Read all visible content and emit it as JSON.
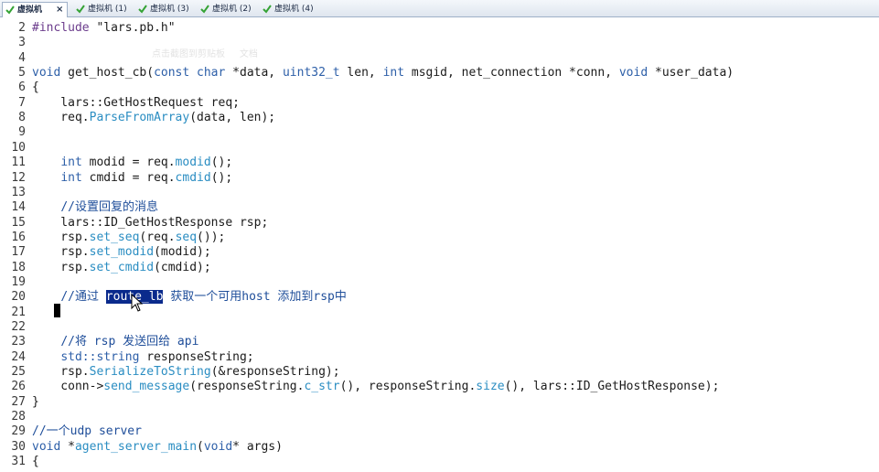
{
  "tabs": [
    {
      "label": "虚拟机",
      "active": true,
      "close": "×"
    },
    {
      "label": "虚拟机 (1)",
      "active": false
    },
    {
      "label": "虚拟机 (3)",
      "active": false
    },
    {
      "label": "虚拟机 (2)",
      "active": false
    },
    {
      "label": "虚拟机 (4)",
      "active": false
    }
  ],
  "ghost_overlay": "点击截图到剪贴板     文档",
  "colors": {
    "keyword": "#2d5fa8",
    "function_call": "#2a8dc2",
    "comment": "#1f4e9a",
    "selection": "#0a2a8c",
    "tab_check": "#35a335"
  },
  "editor": {
    "lines": [
      {
        "num": "2",
        "tokens": [
          [
            "pre",
            "#include"
          ],
          [
            "str",
            " \"lars.pb.h\""
          ]
        ]
      },
      {
        "num": "3",
        "tokens": []
      },
      {
        "num": "4",
        "tokens": []
      },
      {
        "num": "5",
        "tokens": [
          [
            "kw",
            "void"
          ],
          [
            "",
            " get_host_cb("
          ],
          [
            "kw",
            "const"
          ],
          [
            "",
            " "
          ],
          [
            "kw",
            "char"
          ],
          [
            "",
            " *data, "
          ],
          [
            "kw",
            "uint32_t"
          ],
          [
            "",
            " len, "
          ],
          [
            "kw",
            "int"
          ],
          [
            "",
            " msgid, net_connection *conn, "
          ],
          [
            "kw",
            "void"
          ],
          [
            "",
            " *user_data)"
          ]
        ]
      },
      {
        "num": "6",
        "tokens": [
          [
            "",
            "{"
          ]
        ]
      },
      {
        "num": "7",
        "tokens": [
          [
            "",
            "    lars::GetHostRequest req;"
          ]
        ]
      },
      {
        "num": "8",
        "tokens": [
          [
            "",
            "    req."
          ],
          [
            "fn",
            "ParseFromArray"
          ],
          [
            "",
            "(data, len);"
          ]
        ]
      },
      {
        "num": "9",
        "tokens": []
      },
      {
        "num": "10",
        "tokens": []
      },
      {
        "num": "11",
        "tokens": [
          [
            "",
            "    "
          ],
          [
            "kw",
            "int"
          ],
          [
            "",
            " modid = req."
          ],
          [
            "fn",
            "modid"
          ],
          [
            "",
            "();"
          ]
        ]
      },
      {
        "num": "12",
        "tokens": [
          [
            "",
            "    "
          ],
          [
            "kw",
            "int"
          ],
          [
            "",
            " cmdid = req."
          ],
          [
            "fn",
            "cmdid"
          ],
          [
            "",
            "();"
          ]
        ]
      },
      {
        "num": "13",
        "tokens": []
      },
      {
        "num": "14",
        "tokens": [
          [
            "",
            "    "
          ],
          [
            "cmt",
            "//设置回复的消息"
          ]
        ]
      },
      {
        "num": "15",
        "tokens": [
          [
            "",
            "    lars::ID_GetHostResponse rsp;"
          ]
        ]
      },
      {
        "num": "16",
        "tokens": [
          [
            "",
            "    rsp."
          ],
          [
            "fn",
            "set_seq"
          ],
          [
            "",
            "(req."
          ],
          [
            "fn",
            "seq"
          ],
          [
            "",
            "());"
          ]
        ]
      },
      {
        "num": "17",
        "tokens": [
          [
            "",
            "    rsp."
          ],
          [
            "fn",
            "set_modid"
          ],
          [
            "",
            "(modid);"
          ]
        ]
      },
      {
        "num": "18",
        "tokens": [
          [
            "",
            "    rsp."
          ],
          [
            "fn",
            "set_cmdid"
          ],
          [
            "",
            "(cmdid);"
          ]
        ]
      },
      {
        "num": "19",
        "tokens": []
      },
      {
        "num": "20",
        "tokens": [
          [
            "",
            "    "
          ],
          [
            "cmt",
            "//通过 "
          ],
          [
            "sel",
            "route_lb"
          ],
          [
            "cmt",
            " 获取一个可用host 添加到rsp中"
          ]
        ]
      },
      {
        "num": "21",
        "tokens": []
      },
      {
        "num": "22",
        "tokens": []
      },
      {
        "num": "23",
        "tokens": [
          [
            "",
            "    "
          ],
          [
            "cmt",
            "//将 rsp 发送回给 api"
          ]
        ]
      },
      {
        "num": "24",
        "tokens": [
          [
            "",
            "    "
          ],
          [
            "kw",
            "std::string"
          ],
          [
            "",
            " responseString;"
          ]
        ]
      },
      {
        "num": "25",
        "tokens": [
          [
            "",
            "    rsp."
          ],
          [
            "fn",
            "SerializeToString"
          ],
          [
            "",
            "(&responseString);"
          ]
        ]
      },
      {
        "num": "26",
        "tokens": [
          [
            "",
            "    conn->"
          ],
          [
            "fn",
            "send_message"
          ],
          [
            "",
            "(responseString."
          ],
          [
            "fn",
            "c_str"
          ],
          [
            "",
            "(), responseString."
          ],
          [
            "fn",
            "size"
          ],
          [
            "",
            "(), lars::ID_GetHostResponse);"
          ]
        ]
      },
      {
        "num": "27",
        "tokens": [
          [
            "",
            "}"
          ]
        ]
      },
      {
        "num": "28",
        "tokens": []
      },
      {
        "num": "29",
        "tokens": [
          [
            "cmt",
            "//一个udp server"
          ]
        ]
      },
      {
        "num": "30",
        "tokens": [
          [
            "kw",
            "void"
          ],
          [
            "",
            " *"
          ],
          [
            "fn",
            "agent_server_main"
          ],
          [
            "",
            "("
          ],
          [
            "kw",
            "void"
          ],
          [
            "",
            "* args)"
          ]
        ]
      },
      {
        "num": "31",
        "tokens": [
          [
            "",
            "{"
          ]
        ]
      }
    ]
  }
}
